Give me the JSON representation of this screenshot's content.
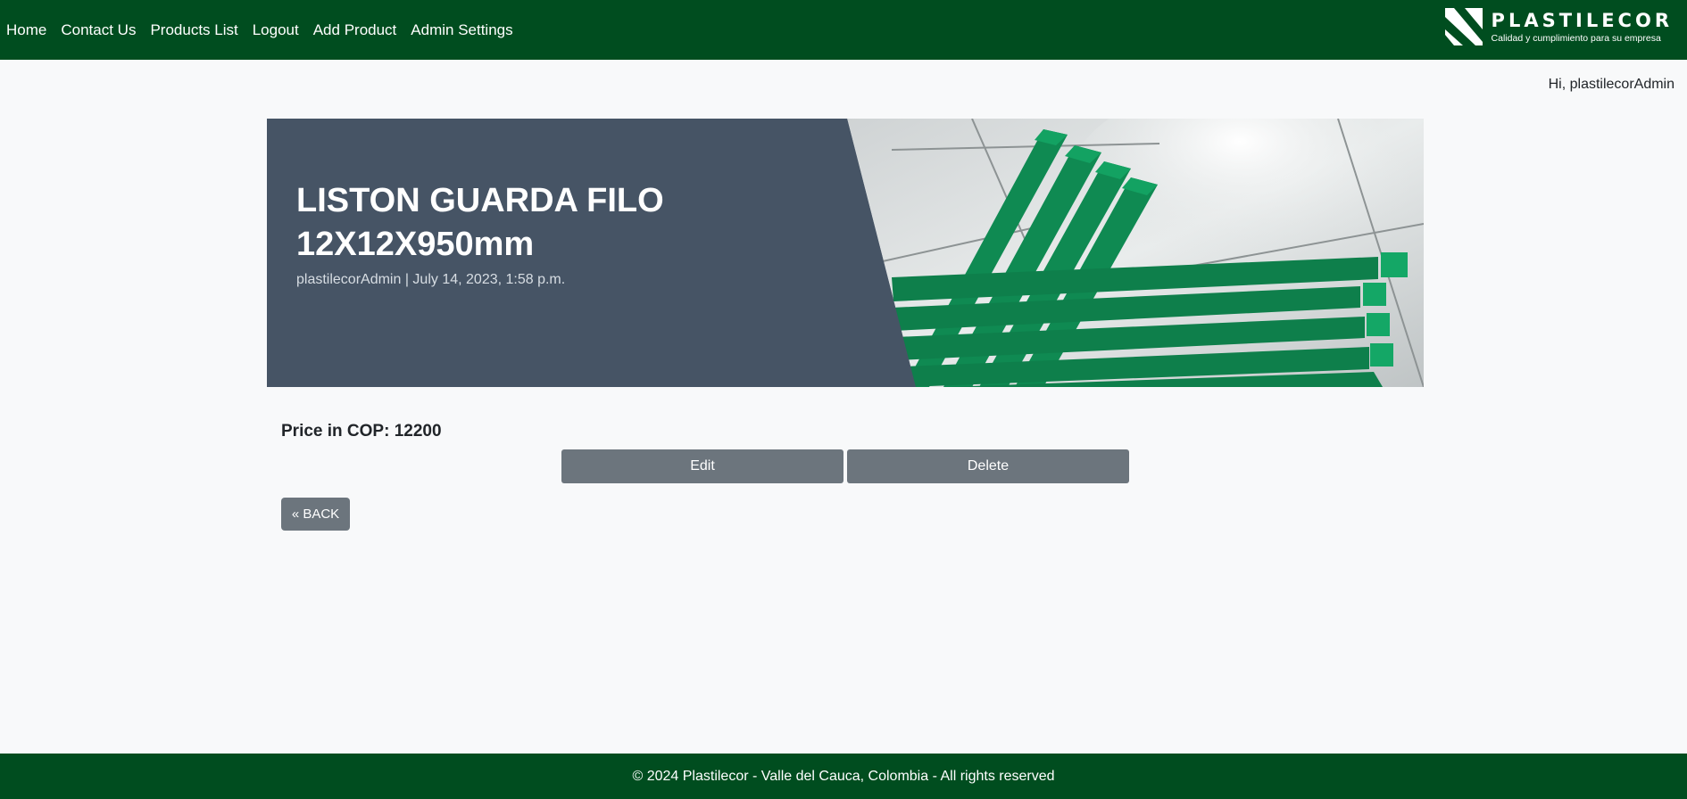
{
  "nav": {
    "items": [
      {
        "label": "Home"
      },
      {
        "label": "Contact Us"
      },
      {
        "label": "Products List"
      },
      {
        "label": "Logout"
      },
      {
        "label": "Add Product"
      },
      {
        "label": "Admin Settings"
      }
    ]
  },
  "brand": {
    "name": "PLASTILECOR",
    "tagline": "Calidad y cumplimiento para su empresa",
    "logo_icon": "plastilecor-logo-icon"
  },
  "greeting": "Hi, plastilecorAdmin",
  "product": {
    "title": "LISTON GUARDA FILO 12X12X950mm",
    "meta": "plastilecorAdmin | July 14, 2023, 1:58 p.m.",
    "price_text": "Price in COP: 12200"
  },
  "actions": {
    "edit_label": "Edit",
    "delete_label": "Delete",
    "back_label": "« BACK"
  },
  "footer": {
    "text": "© 2024 Plastilecor - Valle del Cauca, Colombia - All rights reserved"
  },
  "colors": {
    "navbar": "#004d1f",
    "hero_panel": "#465465",
    "button": "#6c757d",
    "product_green": "#0f8a52"
  }
}
